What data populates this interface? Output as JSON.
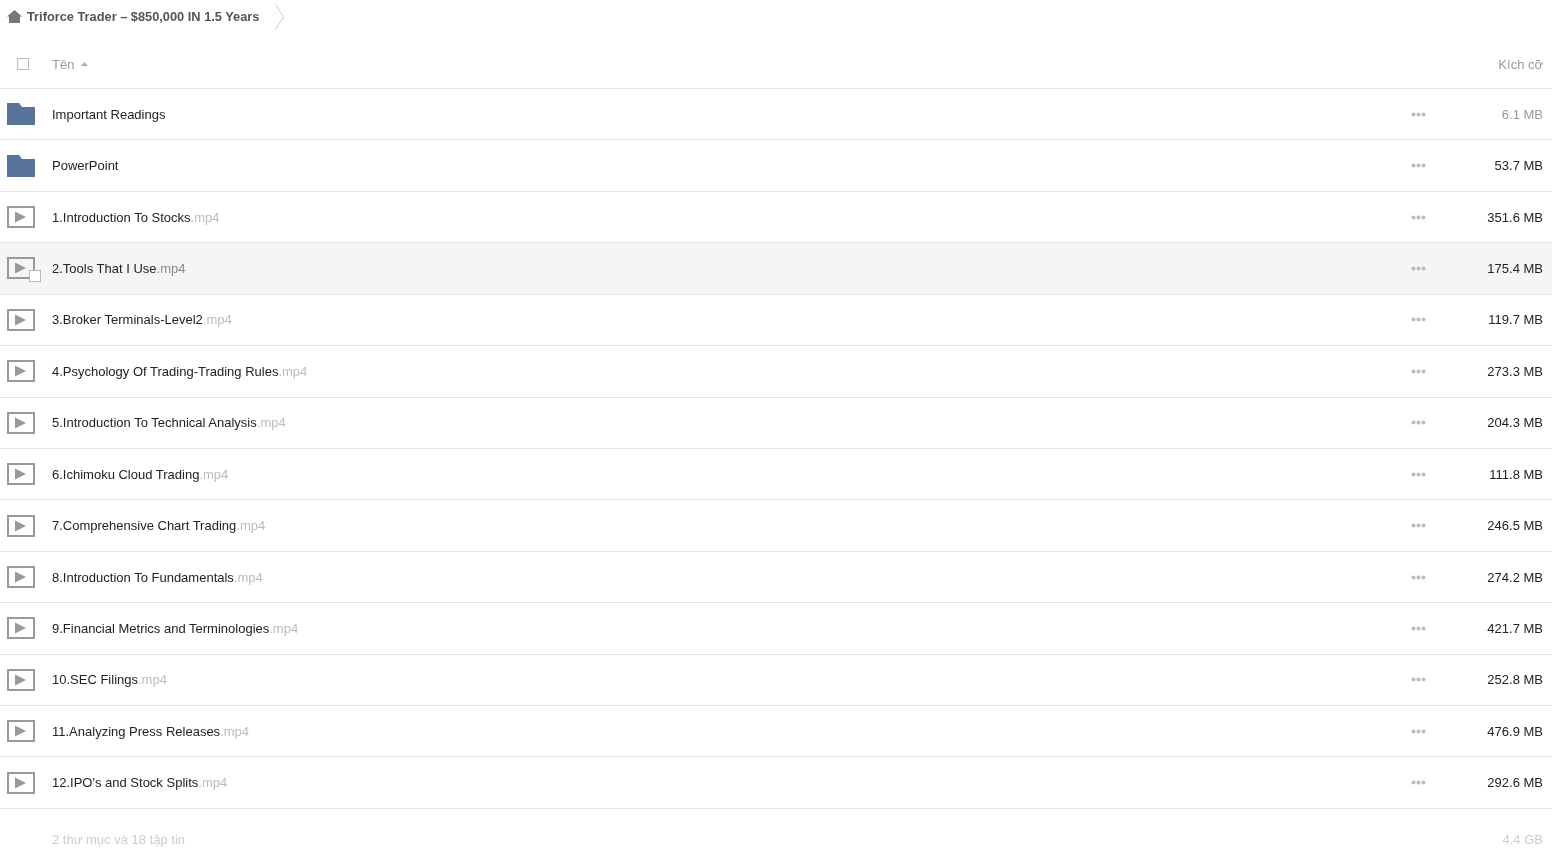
{
  "breadcrumb": {
    "items": [
      {
        "label": "Triforce Trader – $850,000 IN 1.5 Years"
      }
    ]
  },
  "table": {
    "select_all": {
      "checked": false
    },
    "columns": [
      {
        "label": "Tên",
        "sorted": true,
        "descending": false
      },
      {
        "label": "Kích cỡ"
      }
    ],
    "rows": [
      {
        "kind": "folder",
        "name": "Important Readings",
        "size": "6.1 MB",
        "size_dimmed": true,
        "hovered": false,
        "checked": false
      },
      {
        "kind": "folder",
        "name": "PowerPoint",
        "size": "53.7 MB",
        "size_dimmed": false,
        "hovered": false,
        "checked": false
      },
      {
        "kind": "video",
        "name": "1.Introduction To Stocks",
        "extension": ".mp4",
        "size": "351.6 MB",
        "size_dimmed": false,
        "hovered": false,
        "checked": false
      },
      {
        "kind": "video",
        "name": "2.Tools That I Use",
        "extension": ".mp4",
        "size": "175.4 MB",
        "size_dimmed": false,
        "hovered": true,
        "checked": false
      },
      {
        "kind": "video",
        "name": "3.Broker Terminals-Level2",
        "extension": ".mp4",
        "size": "119.7 MB",
        "size_dimmed": false,
        "hovered": false,
        "checked": false
      },
      {
        "kind": "video",
        "name": "4.Psychology Of Trading-Trading Rules",
        "extension": ".mp4",
        "size": "273.3 MB",
        "size_dimmed": false,
        "hovered": false,
        "checked": false
      },
      {
        "kind": "video",
        "name": "5.Introduction To Technical Analysis",
        "extension": ".mp4",
        "size": "204.3 MB",
        "size_dimmed": false,
        "hovered": false,
        "checked": false
      },
      {
        "kind": "video",
        "name": "6.Ichimoku Cloud Trading",
        "extension": ".mp4",
        "size": "111.8 MB",
        "size_dimmed": false,
        "hovered": false,
        "checked": false
      },
      {
        "kind": "video",
        "name": "7.Comprehensive Chart Trading",
        "extension": ".mp4",
        "size": "246.5 MB",
        "size_dimmed": false,
        "hovered": false,
        "checked": false
      },
      {
        "kind": "video",
        "name": "8.Introduction To Fundamentals",
        "extension": ".mp4",
        "size": "274.2 MB",
        "size_dimmed": false,
        "hovered": false,
        "checked": false
      },
      {
        "kind": "video",
        "name": "9.Financial Metrics and Terminologies",
        "extension": ".mp4",
        "size": "421.7 MB",
        "size_dimmed": false,
        "hovered": false,
        "checked": false
      },
      {
        "kind": "video",
        "name": "10.SEC Filings",
        "extension": ".mp4",
        "size": "252.8 MB",
        "size_dimmed": false,
        "hovered": false,
        "checked": false
      },
      {
        "kind": "video",
        "name": "11.Analyzing Press Releases",
        "extension": ".mp4",
        "size": "476.9 MB",
        "size_dimmed": false,
        "hovered": false,
        "checked": false
      },
      {
        "kind": "video",
        "name": "12.IPO's and Stock Splits",
        "extension": ".mp4",
        "size": "292.6 MB",
        "size_dimmed": false,
        "hovered": false,
        "checked": false
      }
    ]
  },
  "summary": {
    "counts": "2 thư mục và 18 tập tin",
    "total_size": "4.4 GB"
  }
}
